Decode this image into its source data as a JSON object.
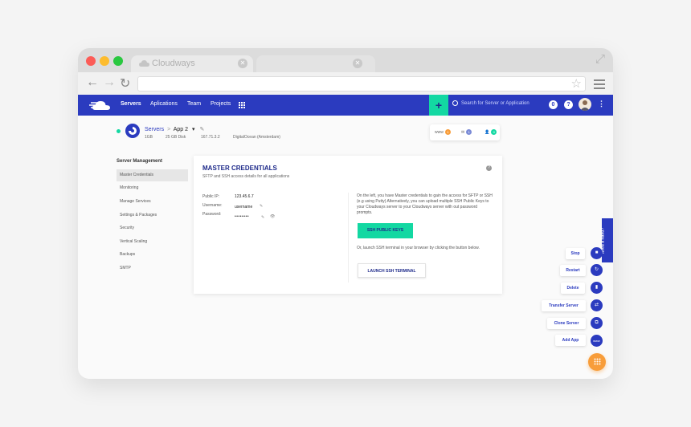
{
  "browser": {
    "tab_title": "Cloudways",
    "nav": {
      "back": "←",
      "forward": "→",
      "reload": "↻"
    },
    "star": "☆",
    "expand": "⤢"
  },
  "topnav": {
    "items": [
      "Servers",
      "Aplications",
      "Team",
      "Projects"
    ],
    "plus": "+",
    "search_placeholder": "Search for Server or Application",
    "notification_count": "0",
    "help": "?",
    "more": "⋮"
  },
  "server": {
    "breadcrumb_root": "Servers",
    "breadcrumb_sep": ">",
    "app_name": "App 2",
    "dropdown": "▾",
    "edit": "✎",
    "ram": "1GB",
    "disk": "25 GB Disk",
    "ip": "167.71.3.2",
    "provider": "DigitalOcean (Amsterdam)"
  },
  "summary": {
    "www_label": "www",
    "www_count": "1",
    "db_count": "1",
    "users_count": "0",
    "colors": {
      "www": "#f89d3a",
      "db": "#7b8bd6",
      "users": "#13d8a2"
    }
  },
  "sidebar": {
    "title": "Server Management",
    "items": [
      "Master Credentials",
      "Monitoring",
      "Manage Services",
      "Settings & Packages",
      "Security",
      "Vertical Scaling",
      "Backups",
      "SMTP"
    ]
  },
  "card": {
    "title": "MASTER CREDENTIALS",
    "subtitle": "SFTP and SSH access details for all applications",
    "help": "?",
    "public_ip_label": "Public IP:",
    "public_ip": "123.45.6.7",
    "username_label": "Username:",
    "username": "username",
    "password_label": "Password:",
    "password": "••••••••",
    "edit": "✎",
    "view": "👁",
    "desc1": "On the left, you have Master credentials to gain the access for SFTP or SSH (e.g using Putty) Alternatively, you can upload multiple SSH Public Keys to your Cloudways server to your Cloudways server with out password prompts.",
    "ssh_keys_button": "SSH PUBLIC KEYS",
    "desc2": "Or, launch SSH terminal in your browser by clicking the button below.",
    "terminal_button": "LAUNCH SSH TERMINAL"
  },
  "help_tab": "Need a hand?",
  "actions": [
    {
      "label": "Stop",
      "icon": "■"
    },
    {
      "label": "Restart",
      "icon": "↻"
    },
    {
      "label": "Delete",
      "icon": "▮"
    },
    {
      "label": "Transfer Server",
      "icon": "⇄"
    },
    {
      "label": "Clone Server",
      "icon": "⧉"
    },
    {
      "label": "Add App",
      "icon": "www"
    }
  ],
  "fab_icon": "⋮⋮⋮",
  "colors": {
    "brand": "#2b3bbf",
    "accent": "#13d8a2",
    "fab": "#f89d3a"
  }
}
